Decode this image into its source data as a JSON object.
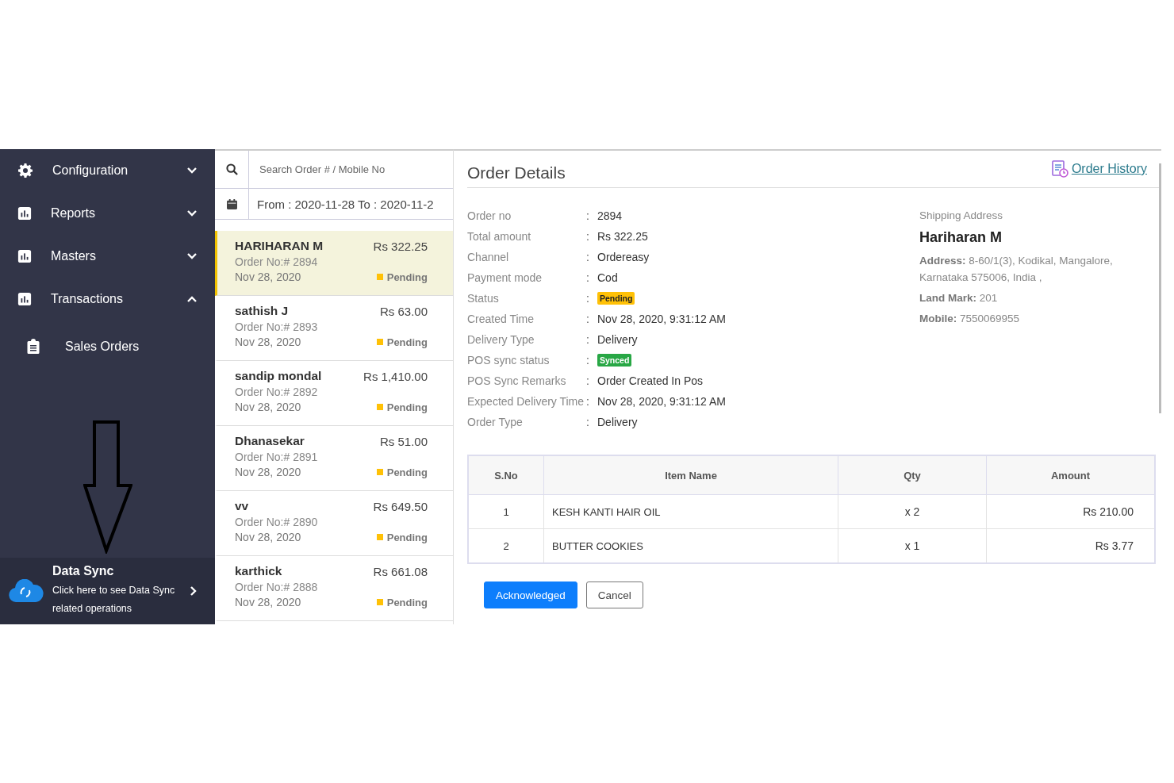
{
  "sidebar": {
    "items": [
      {
        "label": "Configuration",
        "expanded": false
      },
      {
        "label": "Reports",
        "expanded": false
      },
      {
        "label": "Masters",
        "expanded": false
      },
      {
        "label": "Transactions",
        "expanded": true,
        "children": [
          {
            "label": "Sales Orders"
          }
        ]
      }
    ],
    "data_sync": {
      "title": "Data Sync",
      "text": "Click here to see Data Sync related operations"
    }
  },
  "search": {
    "placeholder": "Search Order # / Mobile No"
  },
  "date_range": "From : 2020-11-28 To : 2020-11-2",
  "orders": [
    {
      "name": "HARIHARAN M",
      "amount": "Rs 322.25",
      "order_no": "Order No:# 2894",
      "date": "Nov 28, 2020",
      "status": "Pending",
      "selected": true
    },
    {
      "name": "sathish J",
      "amount": "Rs 63.00",
      "order_no": "Order No:# 2893",
      "date": "Nov 28, 2020",
      "status": "Pending",
      "selected": false
    },
    {
      "name": "sandip mondal",
      "amount": "Rs 1,410.00",
      "order_no": "Order No:# 2892",
      "date": "Nov 28, 2020",
      "status": "Pending",
      "selected": false
    },
    {
      "name": "Dhanasekar",
      "amount": "Rs 51.00",
      "order_no": "Order No:# 2891",
      "date": "Nov 28, 2020",
      "status": "Pending",
      "selected": false
    },
    {
      "name": "vv",
      "amount": "Rs 649.50",
      "order_no": "Order No:# 2890",
      "date": "Nov 28, 2020",
      "status": "Pending",
      "selected": false
    },
    {
      "name": "karthick",
      "amount": "Rs 661.08",
      "order_no": "Order No:# 2888",
      "date": "Nov 28, 2020",
      "status": "Pending",
      "selected": false
    }
  ],
  "details": {
    "title": "Order Details",
    "history_link": "Order History",
    "fields": [
      {
        "label": "Order no",
        "separator": ":",
        "value": "2894",
        "kind": "text"
      },
      {
        "label": "Total amount",
        "separator": ":",
        "value": "Rs 322.25",
        "kind": "text"
      },
      {
        "label": "Channel",
        "separator": ":",
        "value": "Ordereasy",
        "kind": "text"
      },
      {
        "label": "Payment mode",
        "separator": ":",
        "value": "Cod",
        "kind": "text"
      },
      {
        "label": "Status",
        "separator": ":",
        "value": "Pending",
        "kind": "badge",
        "color": "#ffc107"
      },
      {
        "label": "Created Time",
        "separator": ":",
        "value": "Nov 28, 2020, 9:31:12 AM",
        "kind": "text"
      },
      {
        "label": "Delivery Type",
        "separator": ":",
        "value": "Delivery",
        "kind": "text"
      },
      {
        "label": "POS sync status",
        "separator": ":",
        "value": "Synced",
        "kind": "badge",
        "color": "#28a745"
      },
      {
        "label": "POS Sync Remarks",
        "separator": ":",
        "value": "Order Created In Pos",
        "kind": "text"
      },
      {
        "label": "Expected Delivery Time",
        "separator": ":",
        "value": "Nov 28, 2020, 9:31:12 AM",
        "kind": "text"
      },
      {
        "label": "Order Type",
        "separator": ":",
        "value": "Delivery",
        "kind": "text"
      }
    ],
    "shipping": {
      "label": "Shipping Address",
      "name": "Hariharan M",
      "lines": [
        "**Address:** 8-60/1(3), Kodikal, Mangalore, Karnataka 575006, India ,",
        "**Land Mark:** 201",
        "**Mobile:** 7550069955"
      ]
    },
    "table": {
      "columns": [
        "S.No",
        "Item Name",
        "Qty",
        "Amount"
      ],
      "rows": [
        [
          "1",
          "KESH KANTI HAIR OIL",
          "x 2",
          "Rs 210.00"
        ],
        [
          "2",
          "BUTTER COOKIES",
          "x 1",
          "Rs 3.77"
        ]
      ]
    },
    "buttons": [
      {
        "label": "Acknowledged",
        "kind": "primary"
      },
      {
        "label": "Cancel",
        "kind": "secondary"
      }
    ]
  }
}
